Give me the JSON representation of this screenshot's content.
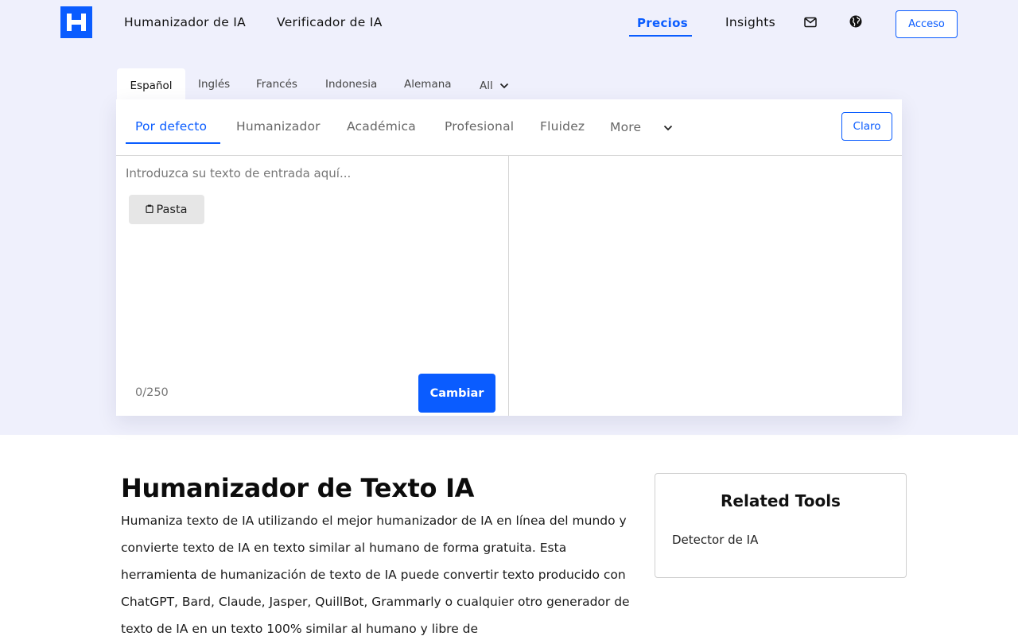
{
  "header": {
    "logo_letter": "H",
    "nav": [
      {
        "label": "Humanizador de IA"
      },
      {
        "label": "Verificador de IA"
      },
      {
        "label": "Precios"
      },
      {
        "label": "Insights"
      }
    ],
    "login_label": "Acceso"
  },
  "languages": [
    "Español",
    "Inglés",
    "Francés",
    "Indonesia",
    "Alemana",
    "All"
  ],
  "modes": [
    "Por defecto",
    "Humanizador",
    "Académica",
    "Profesional",
    "Fluidez",
    "More"
  ],
  "editor": {
    "clear_label": "Claro",
    "placeholder": "Introduzca su texto de entrada aquí...",
    "paste_label": "Pasta",
    "char_count": "0/250",
    "submit_label": "Cambiar"
  },
  "content": {
    "title": "Humanizador de Texto IA",
    "description": "Humaniza texto de IA utilizando el mejor humanizador de IA en línea del mundo y convierte texto de IA en texto similar al humano de forma gratuita. Esta herramienta de humanización de texto de IA puede convertir texto producido con ChatGPT, Bard, Claude, Jasper, QuillBot, Grammarly o cualquier otro generador de texto de IA en un texto 100% similar al humano y libre de"
  },
  "related": {
    "title": "Related Tools",
    "links": [
      "Detector de IA"
    ]
  },
  "colors": {
    "accent": "#0a5cff",
    "hero_bg": "#eff0fc"
  }
}
